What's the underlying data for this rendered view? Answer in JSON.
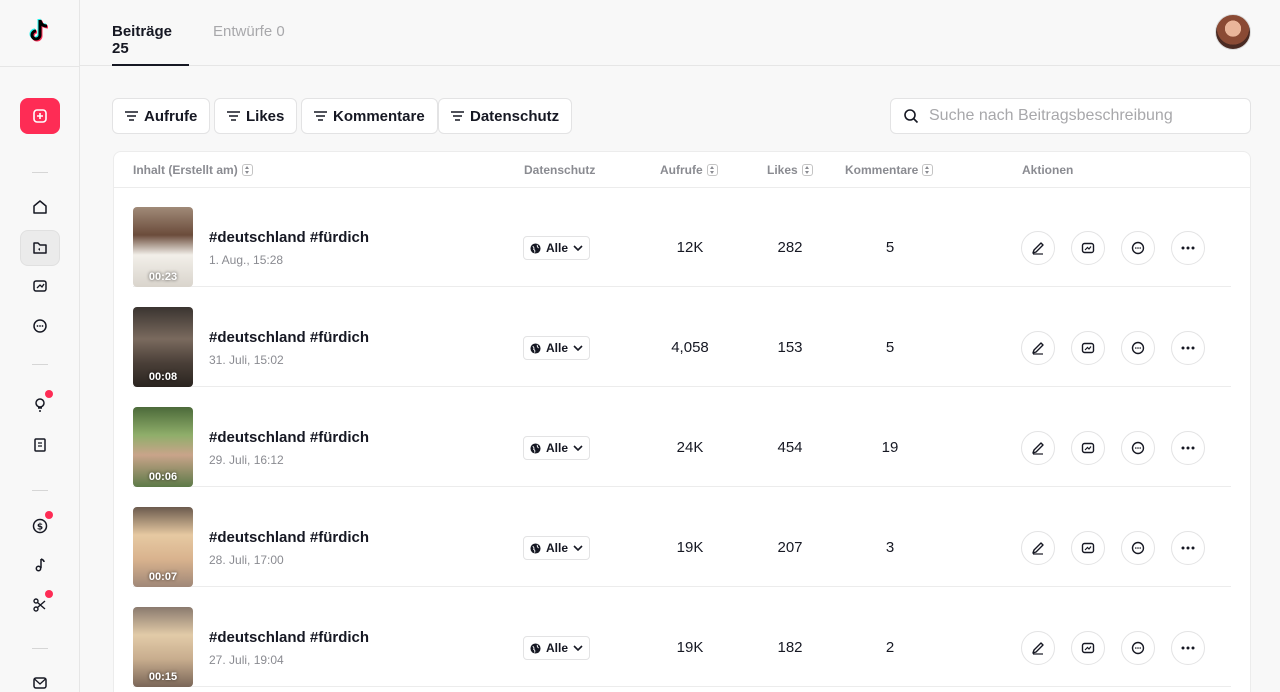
{
  "tabs": {
    "posts": "Beiträge 25",
    "drafts": "Entwürfe 0"
  },
  "filters": [
    "Aufrufe",
    "Likes",
    "Kommentare",
    "Datenschutz"
  ],
  "search": {
    "placeholder": "Suche nach Beitragsbeschreibung"
  },
  "columns": {
    "content": "Inhalt (Erstellt am)",
    "privacy": "Datenschutz",
    "views": "Aufrufe",
    "likes": "Likes",
    "comments": "Kommentare",
    "actions": "Aktionen"
  },
  "rows": [
    {
      "duration": "00:23",
      "title": "#deutschland #fürdich",
      "date": "1. Aug., 15:28",
      "privacy": "Alle",
      "views": "12K",
      "likes": "282",
      "comments": "5"
    },
    {
      "duration": "00:08",
      "title": "#deutschland #fürdich",
      "date": "31. Juli, 15:02",
      "privacy": "Alle",
      "views": "4,058",
      "likes": "153",
      "comments": "5"
    },
    {
      "duration": "00:06",
      "title": "#deutschland #fürdich",
      "date": "29. Juli, 16:12",
      "privacy": "Alle",
      "views": "24K",
      "likes": "454",
      "comments": "19"
    },
    {
      "duration": "00:07",
      "title": "#deutschland #fürdich",
      "date": "28. Juli, 17:00",
      "privacy": "Alle",
      "views": "19K",
      "likes": "207",
      "comments": "3"
    },
    {
      "duration": "00:15",
      "title": "#deutschland #fürdich",
      "date": "27. Juli, 19:04",
      "privacy": "Alle",
      "views": "19K",
      "likes": "182",
      "comments": "2"
    }
  ],
  "colors": {
    "accent": "#fe2c55",
    "text": "#161823",
    "muted": "#8a8b91"
  },
  "icons": {
    "logo": "tiktok-logo-icon",
    "upload": "upload-plus-icon",
    "sidebar": [
      "home-icon",
      "posts-folder-icon",
      "analytics-icon",
      "comments-icon",
      "inspiration-bulb-icon",
      "academy-book-icon",
      "monetization-dollar-icon",
      "music-note-icon",
      "tools-scissors-icon",
      "inbox-mail-icon"
    ],
    "actions": [
      "edit-pencil-icon",
      "analytics-icon",
      "comments-icon",
      "more-dots-icon"
    ]
  }
}
